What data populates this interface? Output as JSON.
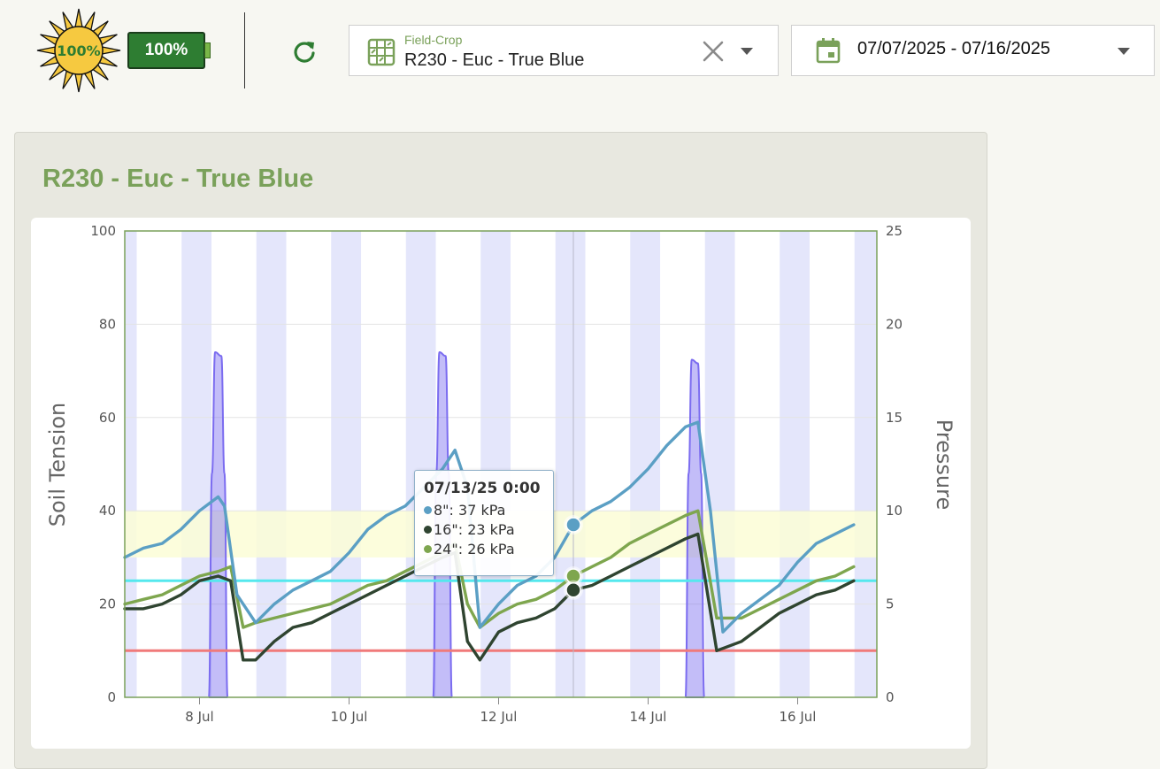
{
  "header": {
    "sun_value": "100%",
    "battery_value": "100%",
    "field_selector": {
      "label": "Field-Crop",
      "value": "R230 - Euc - True Blue"
    },
    "date_range": "07/07/2025 - 07/16/2025"
  },
  "icons": {
    "sun": "sun-icon",
    "battery": "battery-icon",
    "refresh": "refresh-icon",
    "field": "field-icon",
    "clear": "close-icon",
    "caret": "chevron-down-icon",
    "calendar": "calendar-icon"
  },
  "colors": {
    "accent": "#7aa15a",
    "battery": "#2e7d32",
    "refresh": "#2e7d32",
    "series_8": "#5b9fc4",
    "series_16": "#2f4430",
    "series_24": "#7ea64e",
    "pressure": "#7b6cf0",
    "refill_line": "#f07a7a",
    "target_line": "#55e8ee",
    "band": "#fbfdd6",
    "night": "#e4e6fb"
  },
  "card": {
    "title": "R230 - Euc - True Blue"
  },
  "tooltip": {
    "title": "07/13/25 0:00",
    "rows": [
      {
        "label": "8\": 37 kPa",
        "color": "#5b9fc4"
      },
      {
        "label": "16\": 23 kPa",
        "color": "#2f4430"
      },
      {
        "label": "24\": 26 kPa",
        "color": "#7ea64e"
      }
    ]
  },
  "chart_data": {
    "type": "line",
    "title": "",
    "x_start": "2025-07-07",
    "x_end": "2025-07-16",
    "xticks": [
      "8 Jul",
      "10 Jul",
      "12 Jul",
      "14 Jul",
      "16 Jul"
    ],
    "ylabel": "Soil Tension",
    "ylim": [
      0,
      100
    ],
    "yticks": [
      0,
      20,
      40,
      60,
      80,
      100
    ],
    "y2label": "Pressure",
    "y2lim": [
      0,
      25
    ],
    "y2ticks": [
      0,
      5,
      10,
      15,
      20,
      25
    ],
    "optimal_band": [
      30,
      40
    ],
    "refill_line": 10,
    "target_line": 25,
    "crosshair": "2025-07-13 00:00",
    "series": [
      {
        "name": "8\"",
        "unit": "kPa",
        "points": [
          [
            "2025-07-07 00:00",
            30
          ],
          [
            "2025-07-07 06:00",
            32
          ],
          [
            "2025-07-07 12:00",
            33
          ],
          [
            "2025-07-07 18:00",
            36
          ],
          [
            "2025-07-08 00:00",
            40
          ],
          [
            "2025-07-08 06:00",
            43
          ],
          [
            "2025-07-08 08:00",
            41
          ],
          [
            "2025-07-08 12:00",
            22
          ],
          [
            "2025-07-08 18:00",
            16
          ],
          [
            "2025-07-09 00:00",
            20
          ],
          [
            "2025-07-09 06:00",
            23
          ],
          [
            "2025-07-09 12:00",
            25
          ],
          [
            "2025-07-09 18:00",
            27
          ],
          [
            "2025-07-10 00:00",
            31
          ],
          [
            "2025-07-10 06:00",
            36
          ],
          [
            "2025-07-10 12:00",
            39
          ],
          [
            "2025-07-10 18:00",
            41
          ],
          [
            "2025-07-11 00:00",
            45
          ],
          [
            "2025-07-11 06:00",
            49
          ],
          [
            "2025-07-11 10:00",
            53
          ],
          [
            "2025-07-11 14:00",
            45
          ],
          [
            "2025-07-11 18:00",
            15
          ],
          [
            "2025-07-12 00:00",
            20
          ],
          [
            "2025-07-12 06:00",
            24
          ],
          [
            "2025-07-12 12:00",
            26
          ],
          [
            "2025-07-12 18:00",
            30
          ],
          [
            "2025-07-13 00:00",
            37
          ],
          [
            "2025-07-13 06:00",
            40
          ],
          [
            "2025-07-13 12:00",
            42
          ],
          [
            "2025-07-13 18:00",
            45
          ],
          [
            "2025-07-14 00:00",
            49
          ],
          [
            "2025-07-14 06:00",
            54
          ],
          [
            "2025-07-14 12:00",
            58
          ],
          [
            "2025-07-14 16:00",
            59
          ],
          [
            "2025-07-14 20:00",
            40
          ],
          [
            "2025-07-15 00:00",
            14
          ],
          [
            "2025-07-15 06:00",
            18
          ],
          [
            "2025-07-15 12:00",
            21
          ],
          [
            "2025-07-15 18:00",
            24
          ],
          [
            "2025-07-16 00:00",
            29
          ],
          [
            "2025-07-16 06:00",
            33
          ],
          [
            "2025-07-16 12:00",
            35
          ],
          [
            "2025-07-16 18:00",
            37
          ]
        ]
      },
      {
        "name": "16\"",
        "unit": "kPa",
        "points": [
          [
            "2025-07-07 00:00",
            19
          ],
          [
            "2025-07-07 06:00",
            19
          ],
          [
            "2025-07-07 12:00",
            20
          ],
          [
            "2025-07-07 18:00",
            22
          ],
          [
            "2025-07-08 00:00",
            25
          ],
          [
            "2025-07-08 06:00",
            26
          ],
          [
            "2025-07-08 10:00",
            25
          ],
          [
            "2025-07-08 14:00",
            8
          ],
          [
            "2025-07-08 18:00",
            8
          ],
          [
            "2025-07-09 00:00",
            12
          ],
          [
            "2025-07-09 06:00",
            15
          ],
          [
            "2025-07-09 12:00",
            16
          ],
          [
            "2025-07-09 18:00",
            18
          ],
          [
            "2025-07-10 00:00",
            20
          ],
          [
            "2025-07-10 06:00",
            22
          ],
          [
            "2025-07-10 12:00",
            24
          ],
          [
            "2025-07-10 18:00",
            26
          ],
          [
            "2025-07-11 00:00",
            28
          ],
          [
            "2025-07-11 06:00",
            30
          ],
          [
            "2025-07-11 10:00",
            31
          ],
          [
            "2025-07-11 14:00",
            12
          ],
          [
            "2025-07-11 18:00",
            8
          ],
          [
            "2025-07-12 00:00",
            14
          ],
          [
            "2025-07-12 06:00",
            16
          ],
          [
            "2025-07-12 12:00",
            17
          ],
          [
            "2025-07-12 18:00",
            19
          ],
          [
            "2025-07-13 00:00",
            23
          ],
          [
            "2025-07-13 06:00",
            24
          ],
          [
            "2025-07-13 12:00",
            26
          ],
          [
            "2025-07-13 18:00",
            28
          ],
          [
            "2025-07-14 00:00",
            30
          ],
          [
            "2025-07-14 06:00",
            32
          ],
          [
            "2025-07-14 12:00",
            34
          ],
          [
            "2025-07-14 16:00",
            35
          ],
          [
            "2025-07-14 22:00",
            10
          ],
          [
            "2025-07-15 06:00",
            12
          ],
          [
            "2025-07-15 12:00",
            15
          ],
          [
            "2025-07-15 18:00",
            18
          ],
          [
            "2025-07-16 00:00",
            20
          ],
          [
            "2025-07-16 06:00",
            22
          ],
          [
            "2025-07-16 12:00",
            23
          ],
          [
            "2025-07-16 18:00",
            25
          ]
        ]
      },
      {
        "name": "24\"",
        "unit": "kPa",
        "points": [
          [
            "2025-07-07 00:00",
            20
          ],
          [
            "2025-07-07 06:00",
            21
          ],
          [
            "2025-07-07 12:00",
            22
          ],
          [
            "2025-07-07 18:00",
            24
          ],
          [
            "2025-07-08 00:00",
            26
          ],
          [
            "2025-07-08 06:00",
            27
          ],
          [
            "2025-07-08 10:00",
            28
          ],
          [
            "2025-07-08 14:00",
            15
          ],
          [
            "2025-07-08 18:00",
            16
          ],
          [
            "2025-07-09 00:00",
            17
          ],
          [
            "2025-07-09 06:00",
            18
          ],
          [
            "2025-07-09 12:00",
            19
          ],
          [
            "2025-07-09 18:00",
            20
          ],
          [
            "2025-07-10 00:00",
            22
          ],
          [
            "2025-07-10 06:00",
            24
          ],
          [
            "2025-07-10 12:00",
            25
          ],
          [
            "2025-07-10 18:00",
            27
          ],
          [
            "2025-07-11 00:00",
            29
          ],
          [
            "2025-07-11 06:00",
            31
          ],
          [
            "2025-07-11 10:00",
            33
          ],
          [
            "2025-07-11 14:00",
            20
          ],
          [
            "2025-07-11 18:00",
            15
          ],
          [
            "2025-07-12 00:00",
            18
          ],
          [
            "2025-07-12 06:00",
            20
          ],
          [
            "2025-07-12 12:00",
            21
          ],
          [
            "2025-07-12 18:00",
            23
          ],
          [
            "2025-07-13 00:00",
            26
          ],
          [
            "2025-07-13 06:00",
            28
          ],
          [
            "2025-07-13 12:00",
            30
          ],
          [
            "2025-07-13 18:00",
            33
          ],
          [
            "2025-07-14 00:00",
            35
          ],
          [
            "2025-07-14 06:00",
            37
          ],
          [
            "2025-07-14 12:00",
            39
          ],
          [
            "2025-07-14 16:00",
            40
          ],
          [
            "2025-07-14 22:00",
            17
          ],
          [
            "2025-07-15 06:00",
            17
          ],
          [
            "2025-07-15 12:00",
            19
          ],
          [
            "2025-07-15 18:00",
            21
          ],
          [
            "2025-07-16 00:00",
            23
          ],
          [
            "2025-07-16 06:00",
            25
          ],
          [
            "2025-07-16 12:00",
            26
          ],
          [
            "2025-07-16 18:00",
            28
          ]
        ]
      },
      {
        "name": "Pressure",
        "axis": "right",
        "points": [
          [
            "2025-07-08 03:00",
            0
          ],
          [
            "2025-07-08 04:00",
            12
          ],
          [
            "2025-07-08 05:00",
            18.5
          ],
          [
            "2025-07-08 07:00",
            18.3
          ],
          [
            "2025-07-08 08:00",
            12
          ],
          [
            "2025-07-08 09:00",
            0
          ],
          [
            "2025-07-11 03:00",
            0
          ],
          [
            "2025-07-11 04:00",
            12
          ],
          [
            "2025-07-11 05:00",
            18.5
          ],
          [
            "2025-07-11 07:00",
            18.3
          ],
          [
            "2025-07-11 08:00",
            12
          ],
          [
            "2025-07-11 09:00",
            0
          ],
          [
            "2025-07-14 12:00",
            0
          ],
          [
            "2025-07-14 13:00",
            12
          ],
          [
            "2025-07-14 14:00",
            18.1
          ],
          [
            "2025-07-14 16:00",
            17.9
          ],
          [
            "2025-07-14 17:00",
            12
          ],
          [
            "2025-07-14 18:00",
            0
          ]
        ]
      }
    ]
  }
}
